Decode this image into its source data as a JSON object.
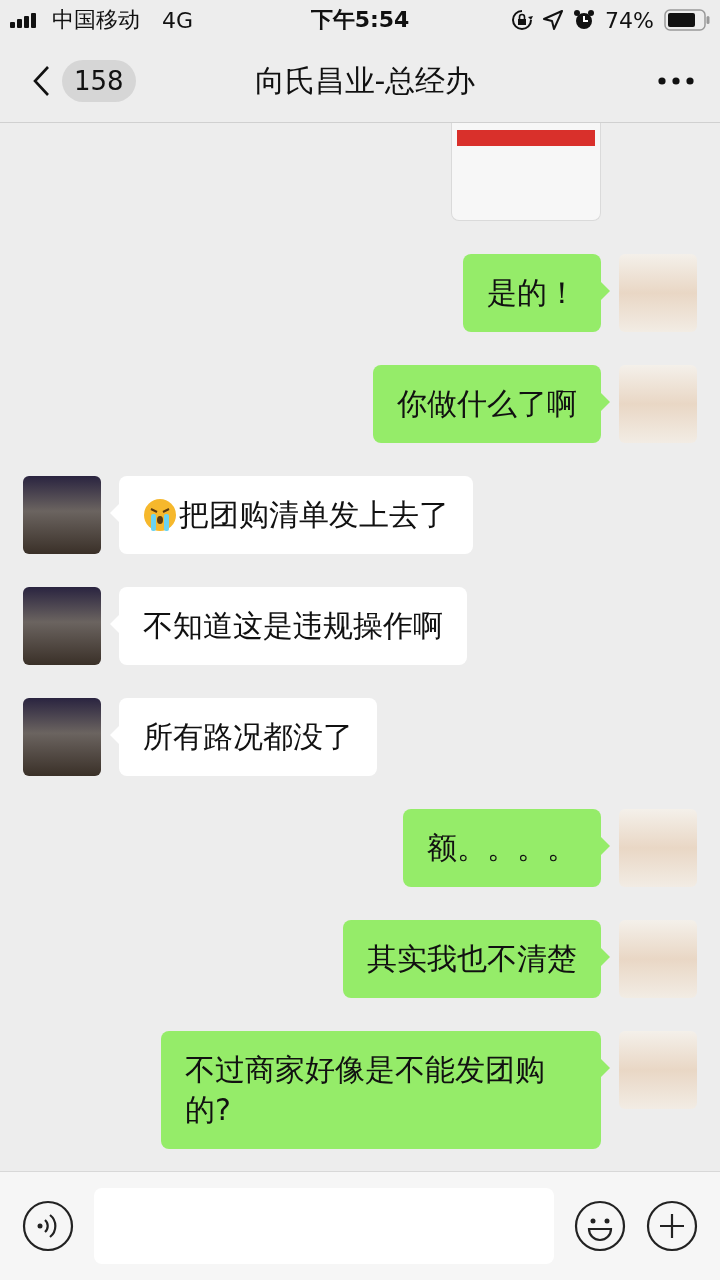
{
  "status_bar": {
    "carrier": "中国移动",
    "network": "4G",
    "time": "下午5:54",
    "battery": "74%"
  },
  "nav": {
    "back_count": "158",
    "title": "向氏昌业-总经办"
  },
  "messages": [
    {
      "kind": "card"
    },
    {
      "kind": "text",
      "outgoing": true,
      "text": "是的！"
    },
    {
      "kind": "text",
      "outgoing": true,
      "text": "你做什么了啊"
    },
    {
      "kind": "text",
      "outgoing": false,
      "text": "把团购清单发上去了",
      "emoji": true
    },
    {
      "kind": "text",
      "outgoing": false,
      "text": "不知道这是违规操作啊"
    },
    {
      "kind": "text",
      "outgoing": false,
      "text": "所有路况都没了"
    },
    {
      "kind": "text",
      "outgoing": true,
      "text": "额。。。。"
    },
    {
      "kind": "text",
      "outgoing": true,
      "text": "其实我也不清楚"
    },
    {
      "kind": "text",
      "outgoing": true,
      "text": "不过商家好像是不能发团购的?"
    }
  ]
}
